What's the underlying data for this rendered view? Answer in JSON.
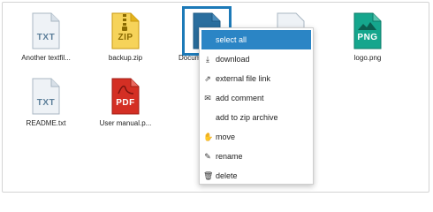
{
  "files": [
    {
      "name": "Another textfil...",
      "type": "TXT"
    },
    {
      "name": "backup.zip",
      "type": "ZIP"
    },
    {
      "name": "Docum",
      "type": ""
    },
    {
      "name": "logo.png",
      "type": "PNG"
    },
    {
      "name": "README.txt",
      "type": "TXT"
    },
    {
      "name": "User manual.p...",
      "type": "PDF"
    }
  ],
  "context_menu": {
    "items": [
      {
        "label": "select all",
        "icon": "",
        "active": true
      },
      {
        "label": "download",
        "icon": "download-icon"
      },
      {
        "label": "external file link",
        "icon": "link-icon"
      },
      {
        "label": "add comment",
        "icon": "comment-icon"
      },
      {
        "label": "add to zip archive",
        "icon": ""
      },
      {
        "label": "move",
        "icon": "hand-icon"
      },
      {
        "label": "rename",
        "icon": "pencil-icon"
      },
      {
        "label": "delete",
        "icon": "trash-icon"
      }
    ]
  },
  "colors": {
    "selection": "#1d7ab8",
    "menu_active": "#2b85c5",
    "zip": "#e3b21c",
    "png": "#11957f",
    "pdf": "#c0271d",
    "txt": "#5b7e99"
  }
}
